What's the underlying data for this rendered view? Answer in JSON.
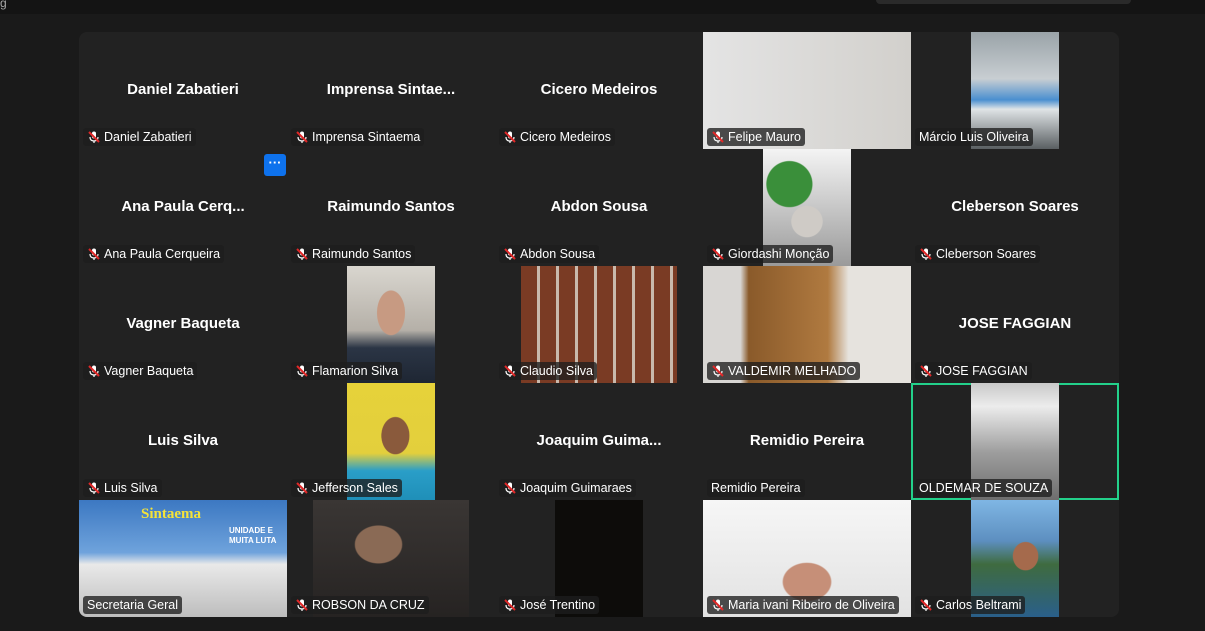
{
  "topbar": {
    "glyph": "g"
  },
  "colors": {
    "active_speaker": "#23d18b",
    "muted_icon": "#e02828",
    "more_button": "#0e72ed"
  },
  "tiles": [
    {
      "name": "Daniel Zabatieri",
      "title": "Daniel Zabatieri",
      "muted": true
    },
    {
      "name": "Imprensa Sintaema",
      "title": "Imprensa  Sintae...",
      "muted": true
    },
    {
      "name": "Cicero Medeiros",
      "title": "Cicero Medeiros",
      "muted": true
    },
    {
      "name": "Felipe Mauro",
      "muted": true
    },
    {
      "name": "Márcio Luis Oliveira",
      "muted": false
    },
    {
      "name": "Ana Paula Cerqueira",
      "title": "Ana  Paula  Cerq...",
      "muted": true
    },
    {
      "name": "Raimundo Santos",
      "title": "Raimundo Santos",
      "muted": true
    },
    {
      "name": "Abdon Sousa",
      "title": "Abdon Sousa",
      "muted": true
    },
    {
      "name": "Giordashi Monção",
      "muted": true
    },
    {
      "name": "Cleberson Soares",
      "title": "Cleberson Soares",
      "muted": true
    },
    {
      "name": "Vagner Baqueta",
      "title": "Vagner Baqueta",
      "muted": true
    },
    {
      "name": "Flamarion Silva",
      "muted": true
    },
    {
      "name": "Claudio Silva",
      "muted": true
    },
    {
      "name": "VALDEMIR MELHADO",
      "muted": true
    },
    {
      "name": "JOSE FAGGIAN",
      "title": "JOSE FAGGIAN",
      "muted": true
    },
    {
      "name": "Luis Silva",
      "title": "Luis Silva",
      "muted": true
    },
    {
      "name": "Jefferson Sales",
      "muted": true
    },
    {
      "name": "Joaquim Guimaraes",
      "title": "Joaquim  Guima...",
      "muted": true
    },
    {
      "name": "Remidio Pereira",
      "title": "Remidio Pereira",
      "muted": false
    },
    {
      "name": "OLDEMAR DE SOUZA",
      "muted": false,
      "active": true
    },
    {
      "name": "Secretaria Geral",
      "muted": false
    },
    {
      "name": "ROBSON DA CRUZ",
      "muted": true
    },
    {
      "name": "José Trentino",
      "muted": true
    },
    {
      "name": "Maria ivani Ribeiro de Oliveira",
      "muted": true
    },
    {
      "name": "Carlos Beltrami",
      "muted": true
    }
  ],
  "more_button": {
    "label": "···"
  },
  "banner": {
    "logo": "Sintaema",
    "slogan_1": "UNIDADE E",
    "slogan_2": "MUITA LUTA"
  }
}
